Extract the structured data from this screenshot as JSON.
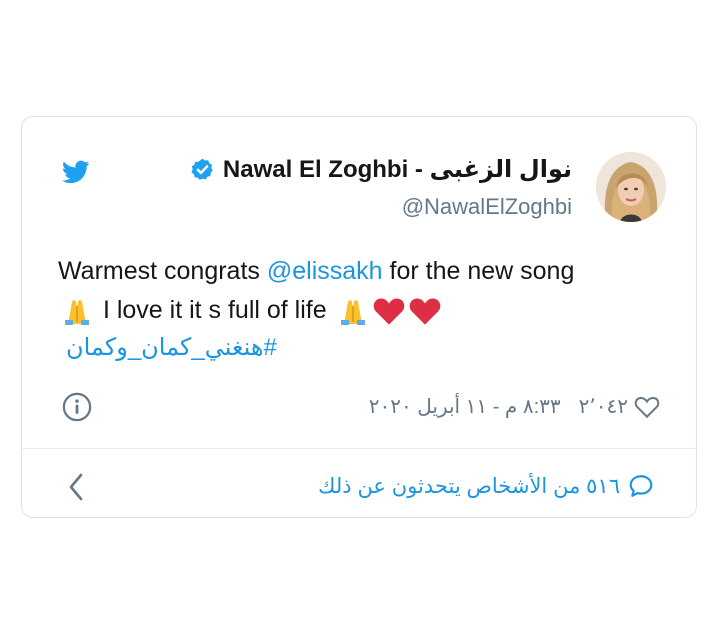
{
  "tweet": {
    "author_name": "Nawal El Zoghbi - نوال الزغبى",
    "author_handle": "@NawalElZoghbi",
    "text_part1": "Warmest congrats ",
    "mention": "@elissakh",
    "text_part2": " for the new song",
    "text_line2": " I love it it s full of life ",
    "hashtag": "#هنغني_كمان_وكمان",
    "likes": "٢٬٠٤٢",
    "timestamp": "٨:٣٣ م - ١١ أبريل ٢٠٢٠",
    "conversation": "٥١٦ من الأشخاص يتحدثون عن ذلك"
  },
  "icons": {
    "logo": "twitter-bird-icon",
    "verified": "verified-badge-icon",
    "info": "info-icon",
    "like": "heart-outline-icon",
    "reply": "speech-bubble-icon",
    "back": "chevron-left-icon"
  },
  "colors": {
    "brand": "#1da1f2",
    "link": "#1b95e0",
    "muted": "#657786",
    "heart": "#dd2e44"
  }
}
